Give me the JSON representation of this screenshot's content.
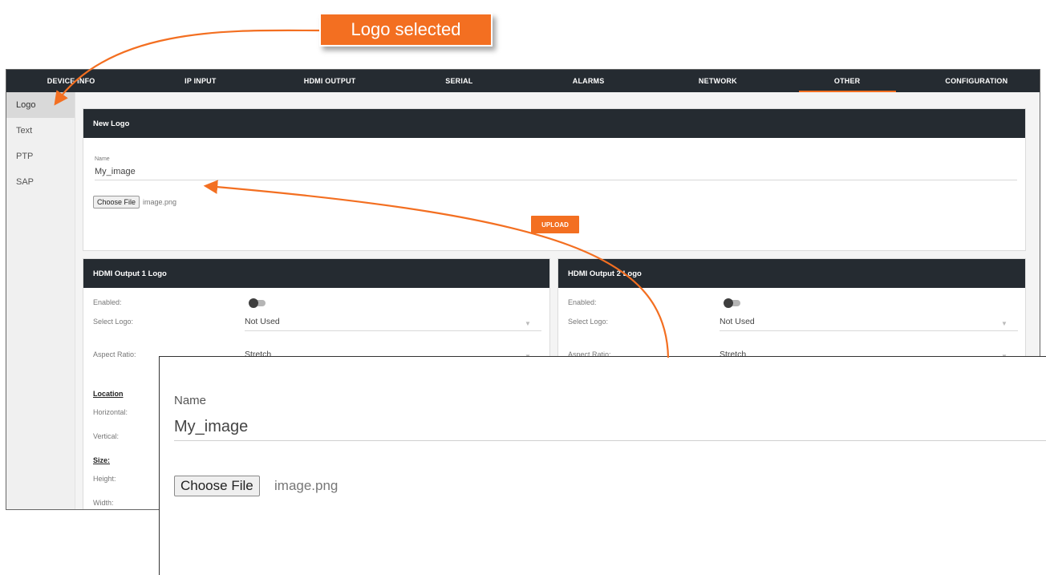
{
  "callout": {
    "text": "Logo selected"
  },
  "colors": {
    "accent": "#f36f21",
    "header": "#252b31"
  },
  "topnav": {
    "tabs": [
      {
        "label": "DEVICE INFO"
      },
      {
        "label": "IP INPUT"
      },
      {
        "label": "HDMI OUTPUT"
      },
      {
        "label": "SERIAL"
      },
      {
        "label": "ALARMS"
      },
      {
        "label": "NETWORK"
      },
      {
        "label": "OTHER",
        "active": true
      },
      {
        "label": "CONFIGURATION"
      }
    ]
  },
  "sidebar": {
    "items": [
      {
        "label": "Logo",
        "active": true
      },
      {
        "label": "Text"
      },
      {
        "label": "PTP"
      },
      {
        "label": "SAP"
      }
    ]
  },
  "new_logo": {
    "title": "New Logo",
    "name_label": "Name",
    "name_value": "My_image",
    "choose_file": "Choose File",
    "file_name": "image.png",
    "upload": "UPLOAD"
  },
  "hdmi1": {
    "title": "HDMI Output 1 Logo",
    "enabled_label": "Enabled:",
    "select_logo_label": "Select Logo:",
    "select_logo_value": "Not Used",
    "aspect_label": "Aspect Ratio:",
    "aspect_value": "Stretch",
    "location_title": "Location",
    "horizontal_label": "Horizontal:",
    "vertical_label": "Vertical:",
    "size_title": "Size:",
    "height_label": "Height:",
    "width_label": "Width:"
  },
  "hdmi2": {
    "title": "HDMI Output 2 Logo",
    "enabled_label": "Enabled:",
    "select_logo_label": "Select Logo:",
    "select_logo_value": "Not Used",
    "aspect_label": "Aspect Ratio:",
    "aspect_value": "Stretch"
  },
  "zoom": {
    "name_label": "Name",
    "name_value": "My_image",
    "choose_file": "Choose File",
    "file_name": "image.png"
  }
}
